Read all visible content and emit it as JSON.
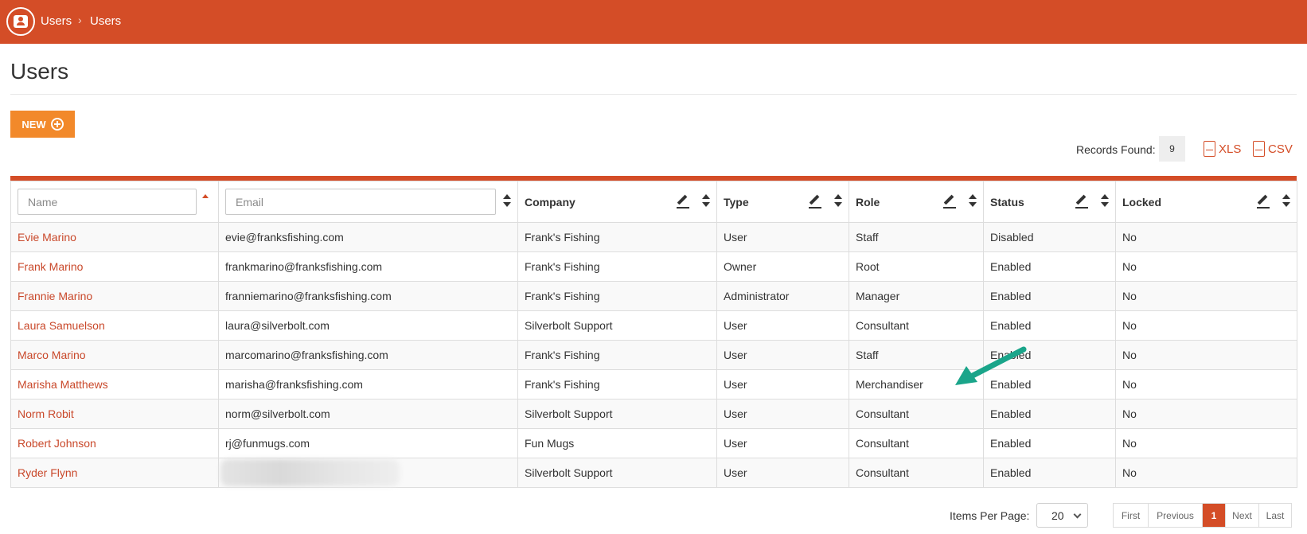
{
  "breadcrumb": [
    "Users",
    "Users"
  ],
  "page": {
    "title": "Users"
  },
  "actions": {
    "new_label": "NEW"
  },
  "records": {
    "label": "Records Found:",
    "count": "9"
  },
  "exports": {
    "xls": "XLS",
    "csv": "CSV"
  },
  "table": {
    "filters": {
      "name_placeholder": "Name",
      "email_placeholder": "Email"
    },
    "headers": {
      "company": "Company",
      "type": "Type",
      "role": "Role",
      "status": "Status",
      "locked": "Locked"
    },
    "rows": [
      {
        "name": "Evie Marino",
        "email": "evie@franksfishing.com",
        "company": "Frank's Fishing",
        "type": "User",
        "role": "Staff",
        "status": "Disabled",
        "locked": "No"
      },
      {
        "name": "Frank Marino",
        "email": "frankmarino@franksfishing.com",
        "company": "Frank's Fishing",
        "type": "Owner",
        "role": "Root",
        "status": "Enabled",
        "locked": "No"
      },
      {
        "name": "Frannie Marino",
        "email": "franniemarino@franksfishing.com",
        "company": "Frank's Fishing",
        "type": "Administrator",
        "role": "Manager",
        "status": "Enabled",
        "locked": "No"
      },
      {
        "name": "Laura Samuelson",
        "email": "laura@silverbolt.com",
        "company": "Silverbolt Support",
        "type": "User",
        "role": "Consultant",
        "status": "Enabled",
        "locked": "No"
      },
      {
        "name": "Marco Marino",
        "email": "marcomarino@franksfishing.com",
        "company": "Frank's Fishing",
        "type": "User",
        "role": "Staff",
        "status": "Enabled",
        "locked": "No"
      },
      {
        "name": "Marisha Matthews",
        "email": "marisha@franksfishing.com",
        "company": "Frank's Fishing",
        "type": "User",
        "role": "Merchandiser",
        "status": "Enabled",
        "locked": "No"
      },
      {
        "name": "Norm Robit",
        "email": "norm@silverbolt.com",
        "company": "Silverbolt Support",
        "type": "User",
        "role": "Consultant",
        "status": "Enabled",
        "locked": "No"
      },
      {
        "name": "Robert Johnson",
        "email": "rj@funmugs.com",
        "company": "Fun Mugs",
        "type": "User",
        "role": "Consultant",
        "status": "Enabled",
        "locked": "No"
      },
      {
        "name": "Ryder Flynn",
        "email": "",
        "company": "Silverbolt Support",
        "type": "User",
        "role": "Consultant",
        "status": "Enabled",
        "locked": "No"
      }
    ]
  },
  "pagination": {
    "items_per_page_label": "Items Per Page:",
    "items_per_page_value": "20",
    "buttons": [
      "First",
      "Previous",
      "1",
      "Next",
      "Last"
    ]
  },
  "colors": {
    "brand": "#d44d27",
    "new_button": "#f2892a",
    "link": "#c9482a",
    "annotation_arrow": "#1aa58a"
  },
  "icons": {
    "app": "user-badge-icon",
    "separator": "chevron-right-icon",
    "sort": "sort-icon",
    "edit": "pencil-icon"
  }
}
